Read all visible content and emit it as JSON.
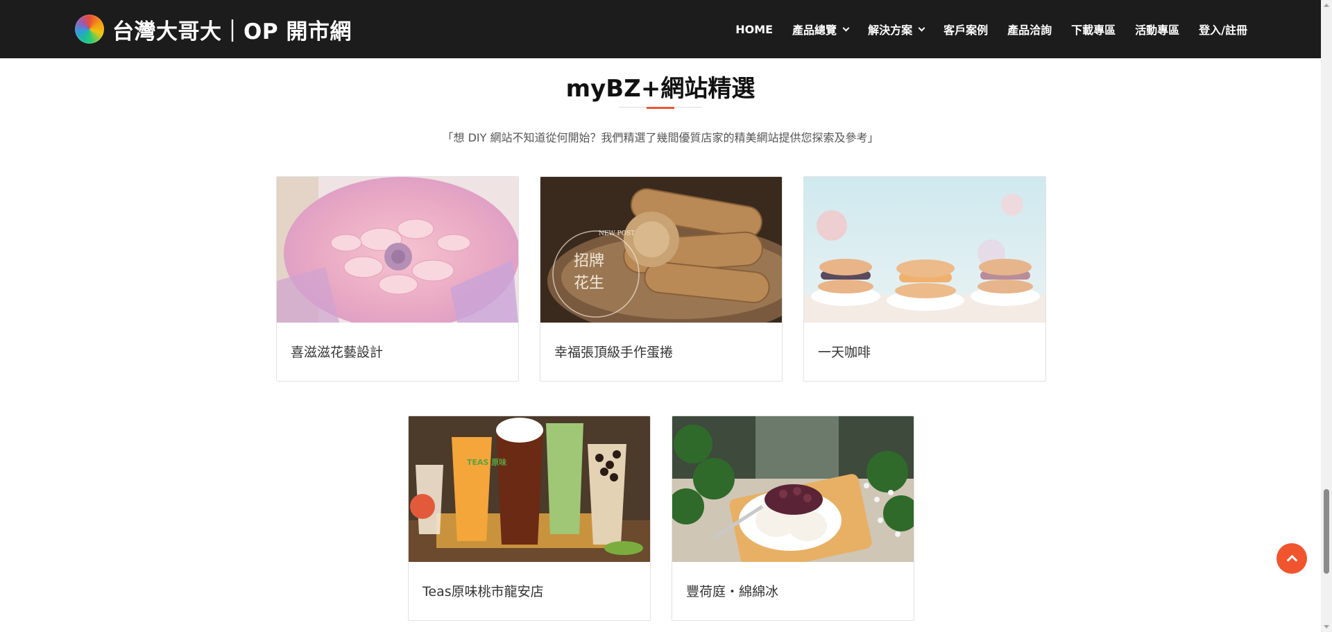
{
  "header": {
    "brand": "台灣大哥大｜OP 開市網",
    "logo_icon": "multicolor-ball-logo",
    "nav": [
      {
        "label": "HOME",
        "dropdown": false
      },
      {
        "label": "產品總覽",
        "dropdown": true
      },
      {
        "label": "解決方案",
        "dropdown": true
      },
      {
        "label": "客戶案例",
        "dropdown": false
      },
      {
        "label": "產品洽詢",
        "dropdown": false
      },
      {
        "label": "下載專區",
        "dropdown": false
      },
      {
        "label": "活動專區",
        "dropdown": false
      },
      {
        "label": "登入/註冊",
        "dropdown": false
      }
    ]
  },
  "section": {
    "title": "myBZ+網站精選",
    "description": "「想 DIY 網站不知道從何開始？我們精選了幾間優質店家的精美網站提供您探索及參考」",
    "accent_color": "#f0552e"
  },
  "cards": [
    {
      "label": "喜滋滋花藝設計",
      "image_icon": "flower-bouquet-image"
    },
    {
      "label": "幸福張頂級手作蛋捲",
      "image_icon": "egg-roll-image",
      "image_text": [
        "招牌",
        "花生"
      ],
      "stamp_text": "NEW POST"
    },
    {
      "label": "一天咖啡",
      "image_icon": "macaron-desserts-image"
    },
    {
      "label": "Teas原味桃市龍安店",
      "image_icon": "tea-drinks-image",
      "cup_text": "TEAS 原味"
    },
    {
      "label": "豐荷庭・綿綿冰",
      "image_icon": "shaved-ice-image"
    }
  ],
  "back_to_top": {
    "icon": "chevron-up-icon",
    "color": "#f0552e"
  }
}
